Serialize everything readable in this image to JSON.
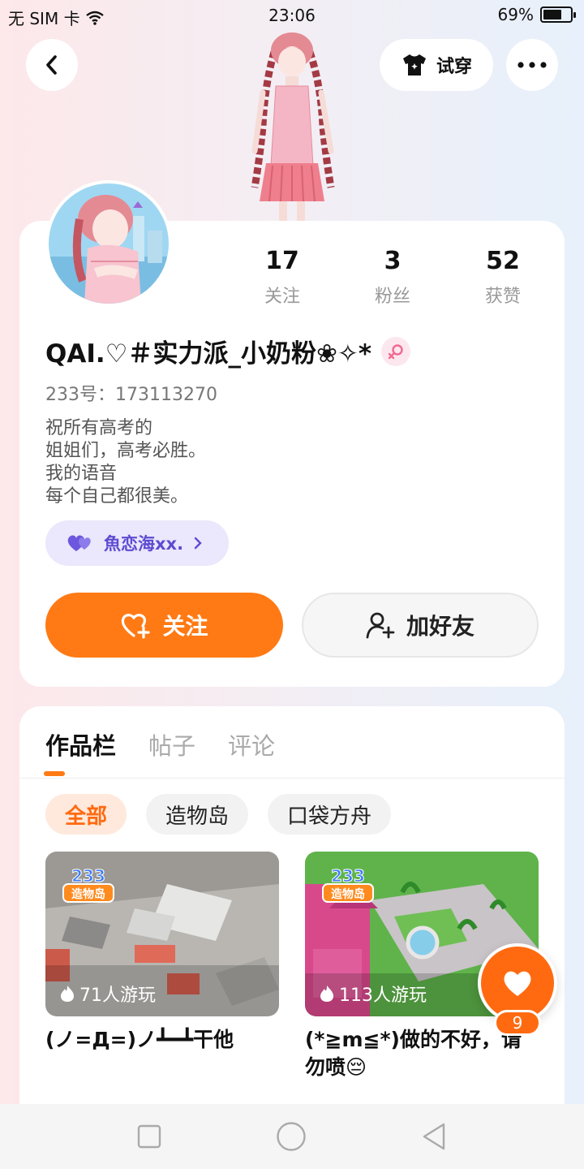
{
  "status_bar": {
    "carrier": "无 SIM 卡",
    "time": "23:06",
    "battery_text": "69%",
    "battery_level": 0.69
  },
  "header": {
    "try_on_label": "试穿"
  },
  "profile": {
    "stats": [
      {
        "value": "17",
        "label": "关注"
      },
      {
        "value": "3",
        "label": "粉丝"
      },
      {
        "value": "52",
        "label": "获赞"
      }
    ],
    "username": "QAI.♡＃实力派_小奶粉❀✧*",
    "user_id": "233号：173113270",
    "bio_lines": [
      "祝所有高考的",
      "姐姐们，高考必胜。",
      "我的语音",
      "每个自己都很美。"
    ],
    "linked_user": "魚恋海xx.",
    "follow_label": "关注",
    "add_friend_label": "加好友"
  },
  "content": {
    "tabs": [
      "作品栏",
      "帖子",
      "评论"
    ],
    "filters": [
      "全部",
      "造物岛",
      "口袋方舟"
    ],
    "works": [
      {
        "badge": "233 造物岛",
        "plays": "71人游玩",
        "title": "(ノ=Д=)ノ┻━┻干他"
      },
      {
        "badge": "233 造物岛",
        "plays": "113人游玩",
        "title": "(*≧m≦*)做的不好，请勿喷😔"
      }
    ]
  },
  "like_fab": {
    "count": "9"
  },
  "colors": {
    "accent": "#ff7a14",
    "link_purple": "#5d4bd1"
  }
}
